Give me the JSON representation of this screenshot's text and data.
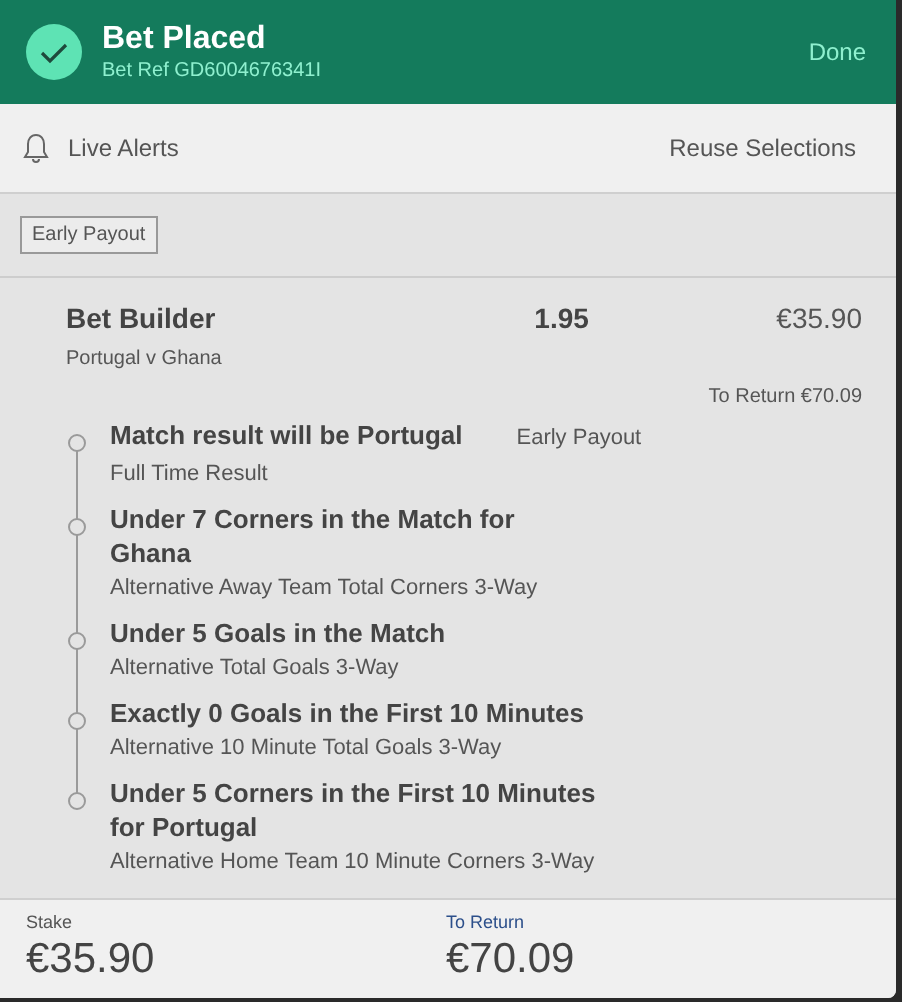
{
  "header": {
    "title": "Bet Placed",
    "bet_ref": "Bet Ref GD6004676341I",
    "done": "Done"
  },
  "actions": {
    "live_alerts": "Live Alerts",
    "reuse": "Reuse Selections"
  },
  "tag": "Early Payout",
  "bet": {
    "title": "Bet Builder",
    "odds": "1.95",
    "stake": "€35.90",
    "event": "Portugal v Ghana",
    "to_return": "To Return €70.09",
    "selections": [
      {
        "name": "Match result will be Portugal",
        "market": "Full Time Result",
        "tag": "Early Payout"
      },
      {
        "name": "Under 7 Corners in the Match for Ghana",
        "market": "Alternative Away Team Total Corners 3-Way"
      },
      {
        "name": "Under 5 Goals in the Match",
        "market": "Alternative Total Goals 3-Way"
      },
      {
        "name": "Exactly 0 Goals in the First 10 Minutes",
        "market": "Alternative 10 Minute Total Goals 3-Way"
      },
      {
        "name": "Under 5 Corners in the First 10 Minutes for Portugal",
        "market": "Alternative Home Team 10 Minute Corners 3-Way"
      }
    ]
  },
  "footer": {
    "stake_label": "Stake",
    "stake": "€35.90",
    "return_label": "To Return",
    "return": "€70.09"
  }
}
